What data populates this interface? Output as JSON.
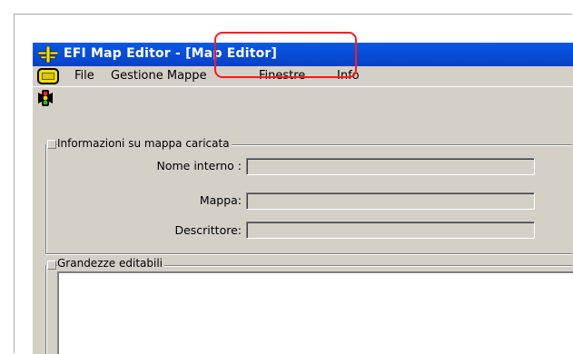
{
  "window": {
    "title_app": "EFI Map Editor",
    "title_sep": " - ",
    "title_doc": "[Map Editor]",
    "highlight_color": "#ff1b1b",
    "title_bar_color": "#0441c6"
  },
  "menu": {
    "icon": "folder-icon",
    "items": [
      "File",
      "Gestione Mappe",
      "Finestre",
      "Info"
    ]
  },
  "toolbar": {
    "icon": "traffic-light-icon"
  },
  "info_group": {
    "label": "Informazioni su mappa caricata",
    "fields": [
      {
        "label": "Nome interno :",
        "value": ""
      },
      {
        "label": "Mappa:",
        "value": ""
      },
      {
        "label": "Descrittore:",
        "value": ""
      }
    ]
  },
  "editable_group": {
    "label": "Grandezze editabili"
  }
}
